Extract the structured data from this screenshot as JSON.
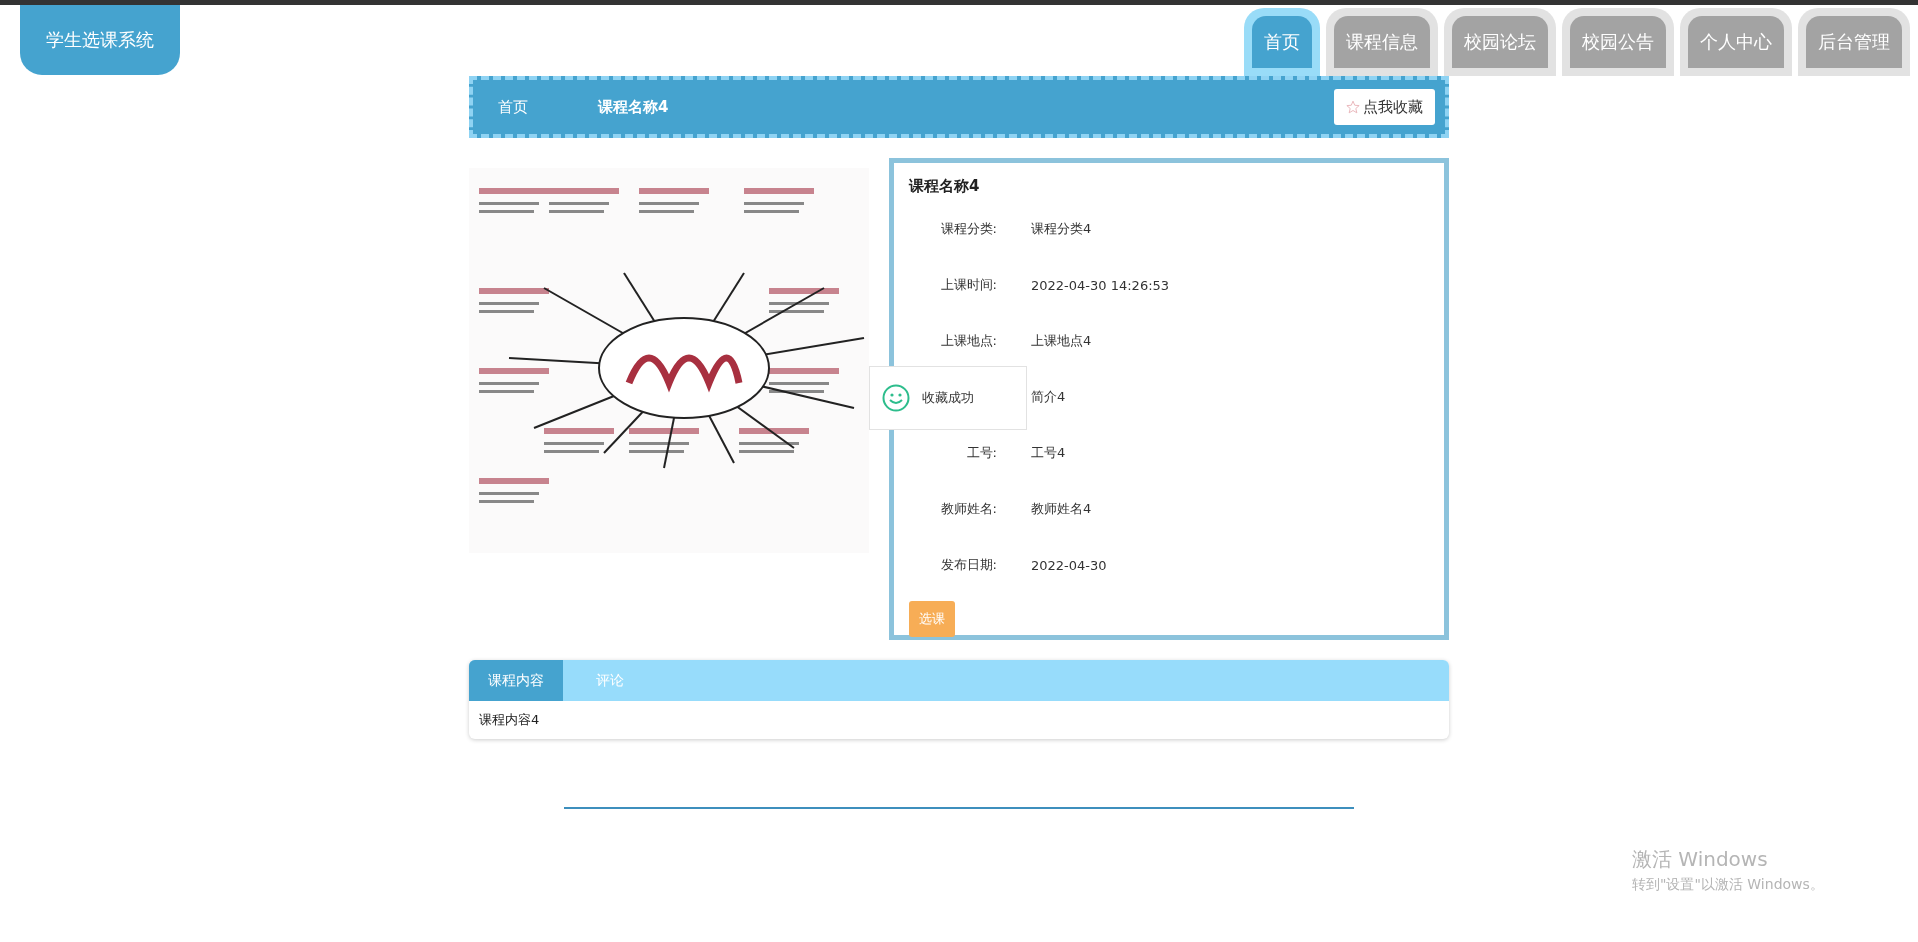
{
  "logo": {
    "title": "学生选课系统"
  },
  "nav": [
    {
      "label": "首页",
      "selected": true
    },
    {
      "label": "课程信息",
      "selected": false
    },
    {
      "label": "校园论坛",
      "selected": false
    },
    {
      "label": "校园公告",
      "selected": false
    },
    {
      "label": "个人中心",
      "selected": false
    },
    {
      "label": "后台管理",
      "selected": false
    }
  ],
  "breadcrumb": [
    "首页",
    "课程名称4"
  ],
  "favorite_button": {
    "label": "点我收藏"
  },
  "detail": {
    "title": "课程名称4",
    "fields": [
      {
        "label": "课程分类:",
        "value": "课程分类4"
      },
      {
        "label": "上课时间:",
        "value": "2022-04-30 14:26:53"
      },
      {
        "label": "上课地点:",
        "value": "上课地点4"
      },
      {
        "value": "简介4"
      },
      {
        "label": "工号:",
        "value": "工号4"
      },
      {
        "label": "教师姓名:",
        "value": "教师姓名4"
      },
      {
        "label": "发布日期:",
        "value": "2022-04-30"
      }
    ],
    "action_button": "选课"
  },
  "toast": {
    "message": "收藏成功"
  },
  "content_tabs": [
    {
      "label": "课程内容",
      "selected": true
    },
    {
      "label": "评论",
      "selected": false
    }
  ],
  "tab_content": "课程内容4",
  "os_notice": {
    "title": "激活 Windows",
    "subtitle": "转到\"设置\"以激活 Windows。"
  }
}
